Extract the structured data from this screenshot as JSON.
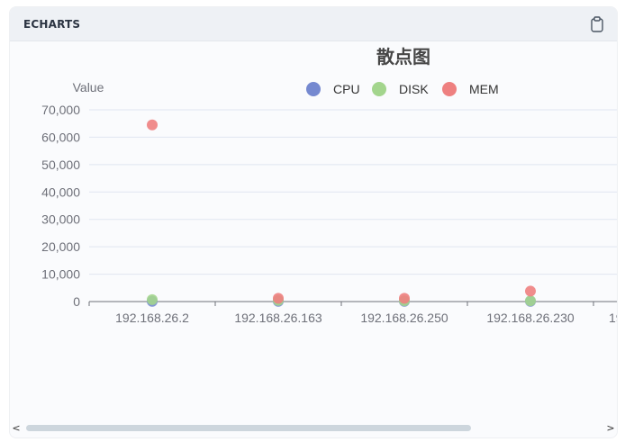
{
  "panel": {
    "header_title": "ECHARTS",
    "icons": {
      "copy": "clipboard-icon",
      "scroll_left": "chevron-left-icon",
      "scroll_right": "chevron-right-icon"
    },
    "scroll_left_glyph": "<",
    "scroll_right_glyph": ">"
  },
  "chart_data": {
    "type": "scatter",
    "title": "散点图",
    "ylabel": "Value",
    "xlabel": "",
    "ylim": [
      0,
      70000
    ],
    "yticks": [
      0,
      10000,
      20000,
      30000,
      40000,
      50000,
      60000,
      70000
    ],
    "ytick_labels": [
      "0",
      "10,000",
      "20,000",
      "30,000",
      "40,000",
      "50,000",
      "60,000",
      "70,000"
    ],
    "grid": true,
    "legend_position": "top-center",
    "categories": [
      "192.168.26.2",
      "192.168.26.163",
      "192.168.26.250",
      "192.168.26.230",
      "19"
    ],
    "series": [
      {
        "name": "CPU",
        "color": "#7589d0",
        "values": [
          100,
          100,
          100,
          100
        ]
      },
      {
        "name": "DISK",
        "color": "#a3d58d",
        "values": [
          700,
          400,
          300,
          300
        ]
      },
      {
        "name": "MEM",
        "color": "#ee8080",
        "values": [
          64500,
          1200,
          1200,
          3800
        ]
      }
    ]
  }
}
